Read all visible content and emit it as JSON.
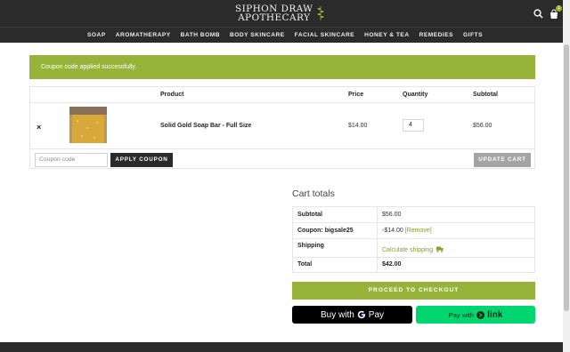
{
  "header": {
    "logo_line1": "SIPHON DRAW",
    "logo_line2": "APOTHECARY",
    "cart_count": "1",
    "nav": [
      "SOAP",
      "AROMATHERAPY",
      "BATH BOMB",
      "BODY SKINCARE",
      "FACIAL SKINCARE",
      "HONEY & TEA",
      "REMEDIES",
      "GIFTS"
    ]
  },
  "notice": {
    "text": "Coupon code applied successfully."
  },
  "cart": {
    "headers": {
      "product": "Product",
      "price": "Price",
      "quantity": "Quantity",
      "subtotal": "Subtotal"
    },
    "item": {
      "remove": "×",
      "name": "Solid Gold Soap Bar - Full Size",
      "price": "$14.00",
      "quantity": "4",
      "subtotal": "$56.00"
    },
    "coupon_placeholder": "Coupon code",
    "apply_label": "APPLY COUPON",
    "update_label": "UPDATE CART"
  },
  "totals": {
    "title": "Cart totals",
    "subtotal_label": "Subtotal",
    "subtotal_value": "$56.00",
    "coupon_label": "Coupon: bigsale25",
    "coupon_value": "-$14.00",
    "coupon_remove": "[Remove]",
    "shipping_label": "Shipping",
    "shipping_value": "Calculate shipping",
    "total_label": "Total",
    "total_value": "$42.00"
  },
  "checkout": {
    "proceed_label": "PROCEED TO CHECKOUT",
    "gpay_prefix": "Buy with",
    "gpay_brand": "Pay",
    "link_prefix": "Pay with",
    "link_brand": "link"
  },
  "colors": {
    "accent": "#97b43a",
    "dark": "#2b2b2b",
    "link_green": "#00d66f"
  }
}
